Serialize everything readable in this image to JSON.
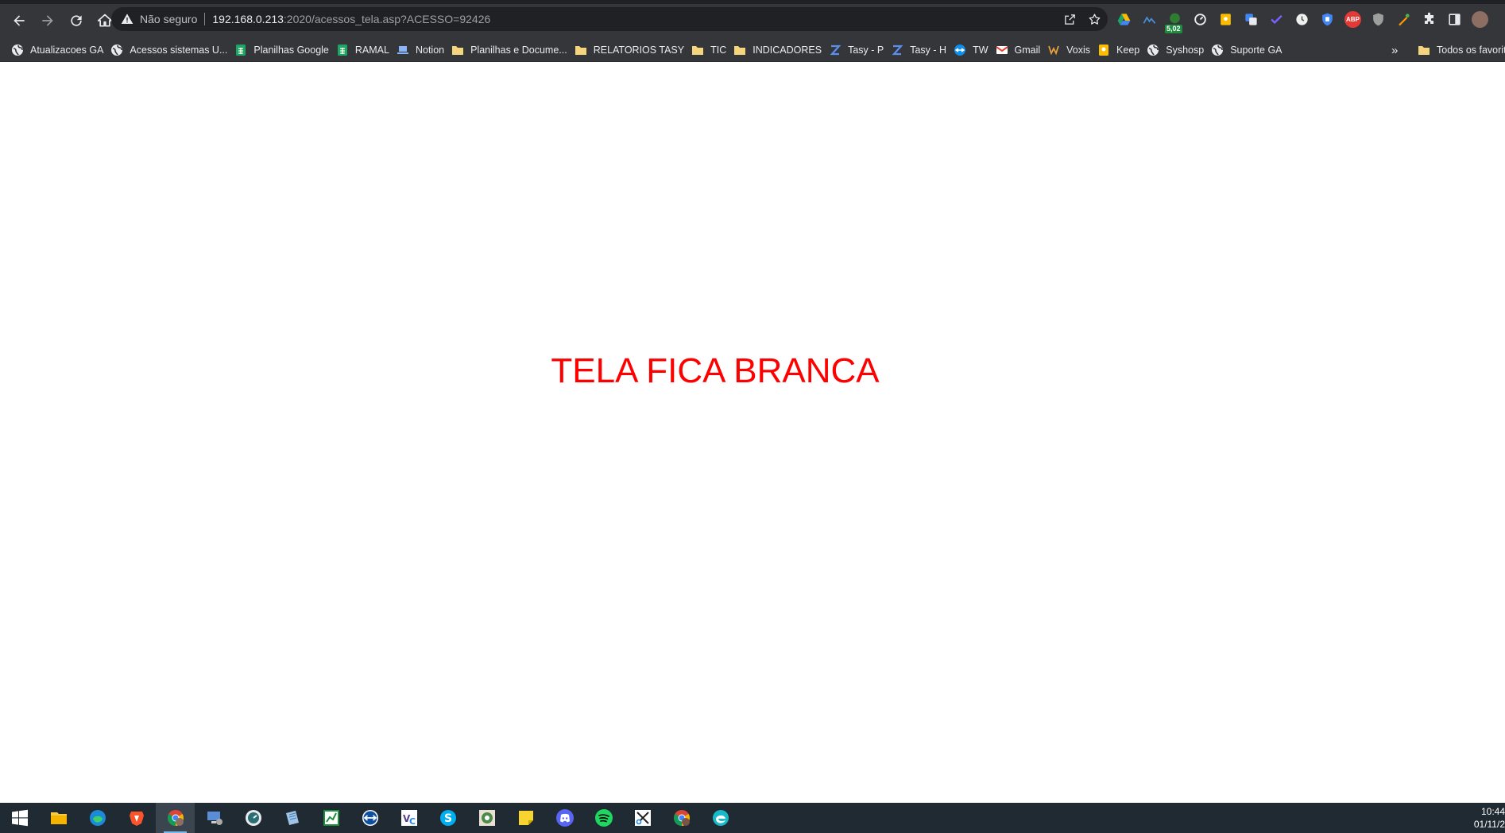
{
  "browser": {
    "security_label": "Não seguro",
    "url_host": "192.168.0.213",
    "url_rest": ":2020/acessos_tela.asp?ACESSO=92426",
    "extensions": [
      {
        "name": "google-drive-icon",
        "color": "#1fa463"
      },
      {
        "name": "stats-extension-icon",
        "color": "#4a90d9"
      },
      {
        "name": "leaf-extension-icon",
        "color": "#2e7d32",
        "badge": "5,02"
      },
      {
        "name": "gauge-extension-icon",
        "color": "#e8eaed"
      },
      {
        "name": "keep-extension-icon",
        "color": "#fbbc04"
      },
      {
        "name": "translate-extension-icon",
        "color": "#4285f4"
      },
      {
        "name": "check-extension-icon",
        "color": "#7b61ff"
      },
      {
        "name": "clock-extension-icon",
        "color": "#f0f0f0"
      },
      {
        "name": "shield-extension-icon",
        "color": "#4285f4"
      },
      {
        "name": "adblock-extension-icon",
        "color": "#e53935",
        "label": "ABP"
      },
      {
        "name": "privacy-badge-extension-icon",
        "color": "#9e9e9e"
      },
      {
        "name": "colorpick-extension-icon",
        "color": "#ff9800"
      }
    ]
  },
  "bookmarks": [
    {
      "label": "Atualizacoes GA",
      "icon": "globe-icon"
    },
    {
      "label": "Acessos sistemas U...",
      "icon": "globe-icon"
    },
    {
      "label": "Planilhas Google",
      "icon": "sheets-icon"
    },
    {
      "label": "RAMAL",
      "icon": "sheets-icon"
    },
    {
      "label": "Notion",
      "icon": "laptop-icon"
    },
    {
      "label": "Planilhas e Docume...",
      "icon": "folder-icon"
    },
    {
      "label": "RELATORIOS TASY",
      "icon": "folder-icon"
    },
    {
      "label": "TIC",
      "icon": "folder-icon"
    },
    {
      "label": "INDICADORES",
      "icon": "folder-icon"
    },
    {
      "label": "Tasy - P",
      "icon": "tasy-icon"
    },
    {
      "label": "Tasy - H",
      "icon": "tasy-icon"
    },
    {
      "label": "TW",
      "icon": "teamviewer-icon"
    },
    {
      "label": "Gmail",
      "icon": "gmail-icon"
    },
    {
      "label": "Voxis",
      "icon": "voxis-icon"
    },
    {
      "label": "Keep",
      "icon": "keep-icon"
    },
    {
      "label": "Syshosp",
      "icon": "globe-icon"
    },
    {
      "label": "Suporte GA",
      "icon": "globe-icon"
    }
  ],
  "bookmarks_more": "»",
  "other_bookmarks": "Todos os favoritos",
  "page": {
    "message": "TELA FICA BRANCA",
    "message_color": "#ff0000"
  },
  "taskbar": {
    "apps": [
      {
        "name": "start-button",
        "active": false
      },
      {
        "name": "file-explorer-icon",
        "active": false
      },
      {
        "name": "edge-icon",
        "active": false
      },
      {
        "name": "brave-icon",
        "active": false
      },
      {
        "name": "chrome-profile-icon",
        "active": true
      },
      {
        "name": "remote-desktop-icon",
        "active": false
      },
      {
        "name": "monitor-app-icon",
        "active": false
      },
      {
        "name": "notes-app-icon",
        "active": false
      },
      {
        "name": "chart-app-icon",
        "active": false
      },
      {
        "name": "teamviewer-icon",
        "active": false
      },
      {
        "name": "vnc-icon",
        "active": false
      },
      {
        "name": "skype-icon",
        "active": false
      },
      {
        "name": "tasy-app-icon",
        "active": false
      },
      {
        "name": "sticky-notes-icon",
        "active": false
      },
      {
        "name": "discord-icon",
        "active": false
      },
      {
        "name": "spotify-icon",
        "active": false
      },
      {
        "name": "snipping-tool-icon",
        "active": false
      },
      {
        "name": "chrome-icon",
        "active": false
      },
      {
        "name": "edge-alt-icon",
        "active": false
      }
    ],
    "time": "10:44",
    "date": "01/11/2"
  }
}
